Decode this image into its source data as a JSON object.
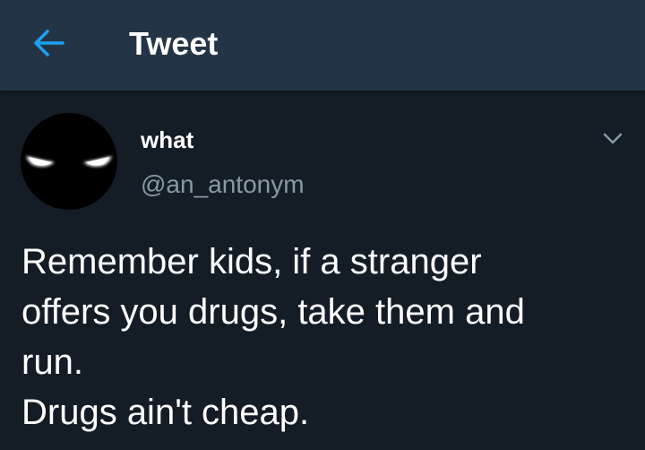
{
  "header": {
    "title": "Tweet",
    "back_icon": "arrow-left-icon",
    "accent_color": "#1da1f2",
    "background": "#243447"
  },
  "tweet": {
    "author": {
      "display_name": "what",
      "handle": "@an_antonym",
      "avatar_icon": "glowing-eyes-avatar"
    },
    "menu_icon": "chevron-down-icon",
    "text_lines": [
      "Remember kids, if a stranger",
      "offers you drugs, take them and",
      "run.",
      "Drugs ain't cheap."
    ]
  },
  "colors": {
    "page_background": "#141d26",
    "secondary_text": "#8899a6"
  }
}
